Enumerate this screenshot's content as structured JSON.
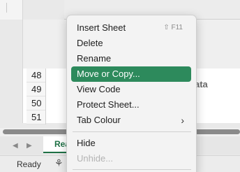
{
  "spreadsheet": {
    "row_numbers": [
      "48",
      "49",
      "50",
      "51"
    ],
    "cell_text": "ata",
    "sheet_tab_label": "Rea",
    "nav_prev_icon": "triangle-left-icon",
    "nav_next_icon": "triangle-right-icon"
  },
  "status_bar": {
    "ready_label": "Ready",
    "accessibility_icon": "accessibility-icon"
  },
  "context_menu": {
    "items": [
      {
        "label": "Insert Sheet",
        "shortcut": "⇧ F11"
      },
      {
        "label": "Delete"
      },
      {
        "label": "Rename"
      },
      {
        "label": "Move or Copy..."
      },
      {
        "label": "View Code"
      },
      {
        "label": "Protect Sheet..."
      },
      {
        "label": "Tab Colour",
        "submenu_icon": "chevron-right-icon"
      },
      {
        "label": "Hide"
      },
      {
        "label": "Unhide..."
      }
    ],
    "highlighted_item": "Move or Copy..."
  },
  "colors": {
    "highlight": "#2d8a5c",
    "sheet_tab_accent": "#1e7145"
  }
}
